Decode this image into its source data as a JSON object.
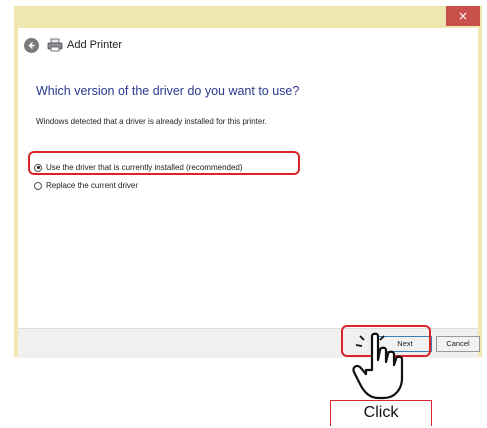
{
  "window": {
    "title": "Add Printer",
    "close_glyph": "×"
  },
  "content": {
    "heading": "Which version of the driver do you want to use?",
    "description": "Windows detected that a driver is already installed for this printer.",
    "options": [
      {
        "label": "Use the driver that is currently installed (recommended)",
        "checked": true,
        "accelerator": "U"
      },
      {
        "label": "Replace the current driver",
        "checked": false,
        "accelerator": "R"
      }
    ]
  },
  "footer": {
    "next_label": "Next",
    "cancel_label": "Cancel"
  },
  "annotation": {
    "click_label": "Click",
    "highlight_color": "#d9242b"
  },
  "icons": {
    "back": "back-arrow-icon",
    "printer": "printer-icon",
    "pointer": "hand-pointer-icon"
  }
}
